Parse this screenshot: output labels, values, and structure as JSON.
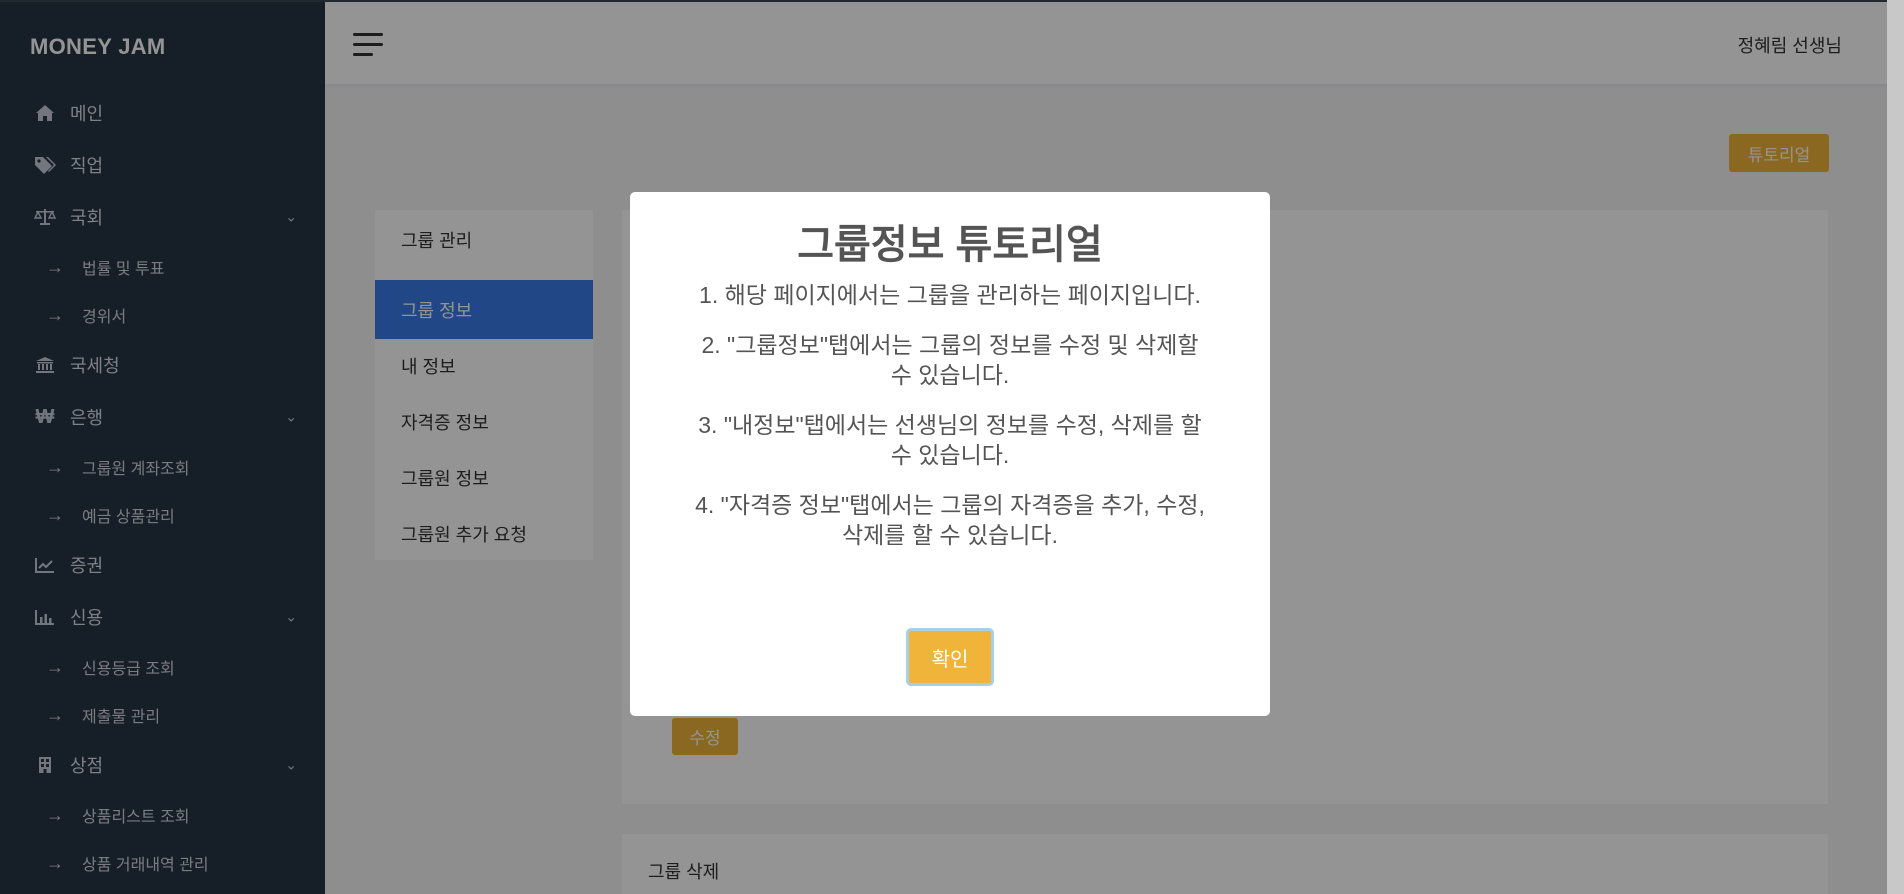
{
  "app": {
    "brand": "MONEY JAM"
  },
  "header": {
    "user_name": "정혜림 선생님"
  },
  "sidebar": {
    "items": [
      {
        "label": "메인",
        "icon": "home-icon"
      },
      {
        "label": "직업",
        "icon": "tags-icon"
      },
      {
        "label": "국회",
        "icon": "balance-scale-icon",
        "expandable": true
      },
      {
        "label": "법률 및 투표",
        "sub": true
      },
      {
        "label": "경위서",
        "sub": true
      },
      {
        "label": "국세청",
        "icon": "bank-icon"
      },
      {
        "label": "은행",
        "icon": "won-icon",
        "expandable": true
      },
      {
        "label": "그룹원 계좌조회",
        "sub": true
      },
      {
        "label": "예금 상품관리",
        "sub": true
      },
      {
        "label": "증권",
        "icon": "line-chart-icon"
      },
      {
        "label": "신용",
        "icon": "bar-chart-icon",
        "expandable": true
      },
      {
        "label": "신용등급 조회",
        "sub": true
      },
      {
        "label": "제출물 관리",
        "sub": true
      },
      {
        "label": "상점",
        "icon": "store-icon",
        "expandable": true
      },
      {
        "label": "상품리스트 조회",
        "sub": true
      },
      {
        "label": "상품 거래내역 관리",
        "sub": true
      }
    ],
    "sub_arrow": "→"
  },
  "content": {
    "tutorial_button": "튜토리얼",
    "tabs": [
      "그룹 관리",
      "그룹 정보",
      "내 정보",
      "자격증 정보",
      "그룹원 정보",
      "그룹원 추가 요청"
    ],
    "edit_button": "수정",
    "delete_panel_label": "그룹 삭제"
  },
  "modal": {
    "title": "그룹정보 튜토리얼",
    "items": [
      "1. 해당 페이지에서는 그룹을 관리하는 페이지입니다.",
      "2. \"그룹정보\"탭에서는 그룹의 정보를 수정 및 삭제할 수 있습니다.",
      "3. \"내정보\"탭에서는 선생님의 정보를 수정, 삭제를 할 수 있습니다.",
      "4. \"자격증 정보\"탭에서는 그룹의 자격증을 추가, 수정, 삭제를 할 수 있습니다."
    ],
    "confirm_button": "확인"
  },
  "colors": {
    "sidebar_bg": "#273444",
    "accent_yellow": "#f0b43a",
    "active_tab": "#3a7ae8"
  }
}
